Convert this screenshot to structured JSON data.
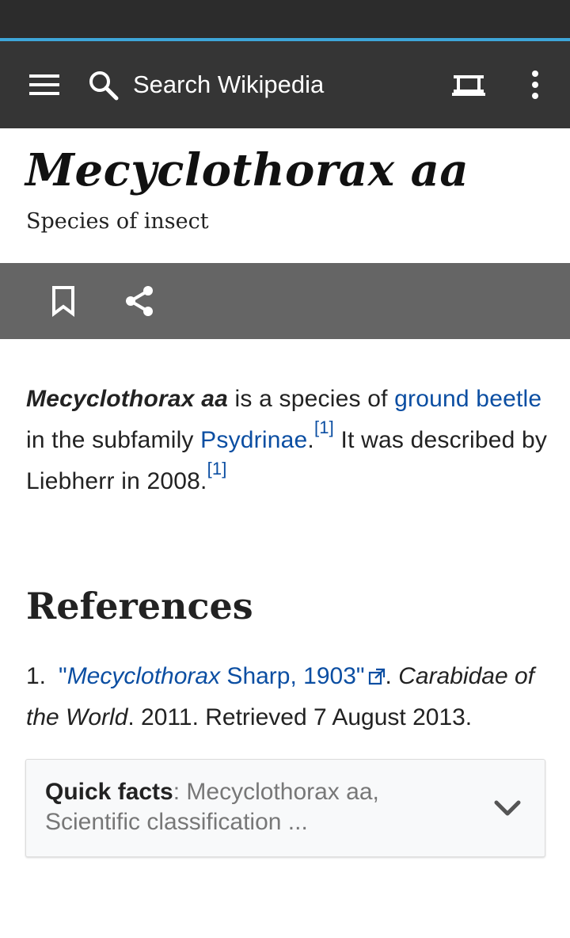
{
  "toolbar": {
    "search_placeholder": "Search Wikipedia"
  },
  "article": {
    "title": "Mecyclothorax aa",
    "description": "Species of insect",
    "lead": {
      "bold_term": "Mecyclothorax aa",
      "text_1": " is a species of ",
      "link_1": "ground beetle",
      "text_2": " in the subfamily ",
      "link_2": "Psydrinae",
      "text_3": ".",
      "ref_1": "[1]",
      "text_4": " It was described by Liebherr in 2008.",
      "ref_2": "[1]"
    }
  },
  "references": {
    "heading": "References",
    "items": [
      {
        "number": "1.",
        "link_quote_open": "\"",
        "link_italic": "Mecyclothorax",
        "link_rest": " Sharp, 1903\"",
        "after_link": ". ",
        "italic_source": "Carabidae of the World",
        "tail": ". 2011. Retrieved 7 August 2013."
      }
    ]
  },
  "quick_facts": {
    "label": "Quick facts",
    "separator": ": ",
    "summary": "Mecyclothorax aa, Scientific classification ..."
  },
  "colors": {
    "toolbar_bg": "#353535",
    "actionbar_bg": "#656565",
    "link": "#0b4ea2",
    "progress": "#3ea6d9"
  }
}
